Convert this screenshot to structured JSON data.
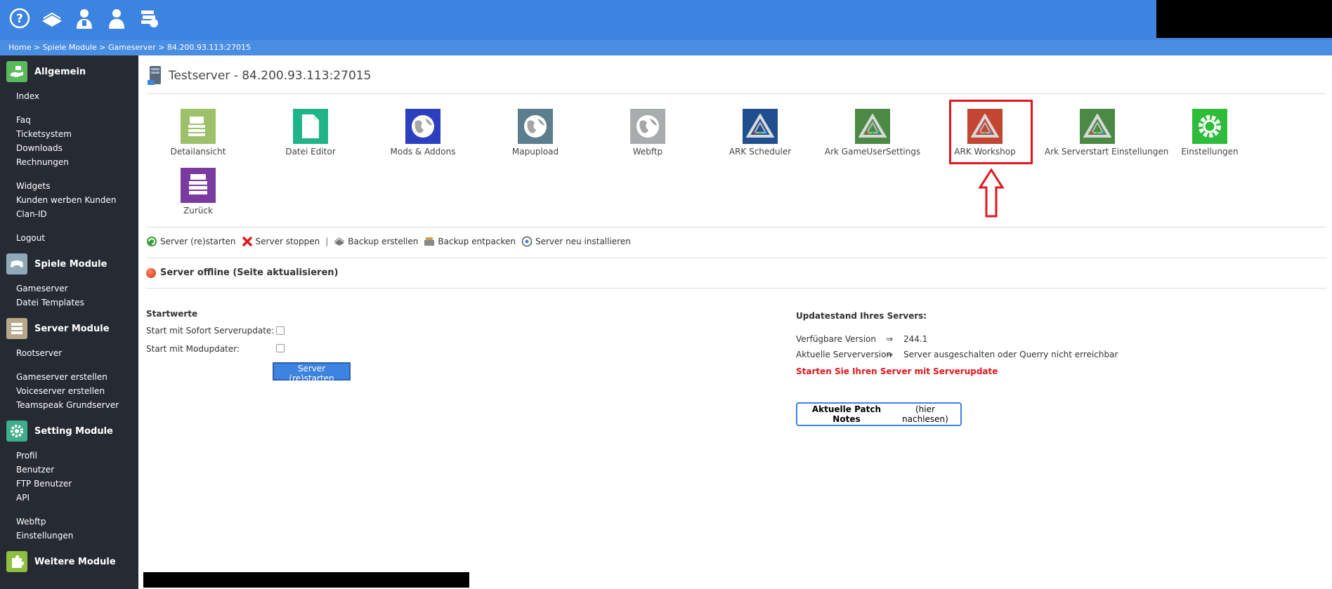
{
  "topbar": {
    "icons": [
      "help-icon",
      "book-icon",
      "support-agent-icon",
      "user-icon",
      "money-icon"
    ]
  },
  "breadcrumb": {
    "items": [
      "Home",
      "Spiele Module",
      "Gameserver",
      "84.200.93.113:27015"
    ],
    "separator": " > "
  },
  "sidebar": {
    "sections": [
      {
        "title": "Allgemein",
        "icon": "hand-money-icon",
        "color": "#5cb85c",
        "groups": [
          [
            "Index"
          ],
          [
            "Faq",
            "Ticketsystem",
            "Downloads",
            "Rechnungen"
          ],
          [
            "Widgets",
            "Kunden werben Kunden",
            "Clan-ID"
          ],
          [
            "Logout"
          ]
        ]
      },
      {
        "title": "Spiele Module",
        "icon": "gamepad-icon",
        "color": "#8fa9b8",
        "groups": [
          [
            "Gameserver",
            "Datei Templates"
          ]
        ]
      },
      {
        "title": "Server Module",
        "icon": "server-stack-icon",
        "color": "#b8a98a",
        "groups": [
          [
            "Rootserver"
          ],
          [
            "Gameserver erstellen",
            "Voiceserver erstellen",
            "Teamspeak Grundserver"
          ]
        ]
      },
      {
        "title": "Setting Module",
        "icon": "gear-icon",
        "color": "#3fae8a",
        "groups": [
          [
            "Profil",
            "Benutzer",
            "FTP Benutzer",
            "API"
          ],
          [
            "Webftp",
            "Einstellungen"
          ]
        ]
      },
      {
        "title": "Weitere Module",
        "icon": "puzzle-icon",
        "color": "#8fbf3f",
        "groups": []
      }
    ]
  },
  "main": {
    "title": "Testserver - 84.200.93.113:27015",
    "tiles": [
      {
        "label": "Detailansicht",
        "color": "#9dc06b",
        "icon": "detail-view-icon"
      },
      {
        "label": "Datei Editor",
        "color": "#1fb589",
        "icon": "file-editor-icon"
      },
      {
        "label": "Mods & Addons",
        "color": "#2c3fbe",
        "icon": "globe-icon"
      },
      {
        "label": "Mapupload",
        "color": "#5b7d8d",
        "icon": "globe-icon"
      },
      {
        "label": "Webftp",
        "color": "#a9acac",
        "icon": "globe-icon"
      },
      {
        "label": "ARK Scheduler",
        "color": "#1f4f8f",
        "icon": "ark-logo-icon"
      },
      {
        "label": "Ark GameUserSettings",
        "color": "#4b8a45",
        "icon": "ark-logo-icon"
      },
      {
        "label": "ARK Workshop",
        "color": "#c24632",
        "icon": "ark-logo-icon"
      },
      {
        "label": "Ark Serverstart Einstellungen",
        "color": "#4b8a45",
        "icon": "ark-logo-icon"
      },
      {
        "label": "Einstellungen",
        "color": "#2ebd3b",
        "icon": "gear-icon"
      },
      {
        "label": "Zurück",
        "color": "#7b3aa0",
        "icon": "back-icon"
      }
    ],
    "actions": [
      {
        "label": "Server (re)starten",
        "icon": "restart-icon"
      },
      {
        "label": "Server stoppen",
        "icon": "stop-icon"
      },
      {
        "label": "Backup erstellen",
        "icon": "backup-icon"
      },
      {
        "label": "Backup entpacken",
        "icon": "unpack-icon"
      },
      {
        "label": "Server neu installieren",
        "icon": "reinstall-icon"
      }
    ],
    "action_separator": "|",
    "status": "Server offline (Seite aktualisieren)",
    "startwerte": {
      "title": "Startwerte",
      "option1": "Start mit Sofort Serverupdate:",
      "option2": "Start mit Modupdater:",
      "button": "Server (re)starten"
    },
    "update": {
      "title": "Updatestand Ihres Servers:",
      "row1_label": "Verfügbare Version",
      "row1_value": "244.1",
      "row2_label": "Aktuelle Serverversion",
      "row2_value": "Server ausgeschalten oder Querry nicht erreichbar",
      "arrow": "⇒",
      "warning": "Starten Sie Ihren Server mit Serverupdate",
      "patch_bold": "Aktuelle Patch Notes",
      "patch_normal": "(hier nachlesen)"
    }
  }
}
